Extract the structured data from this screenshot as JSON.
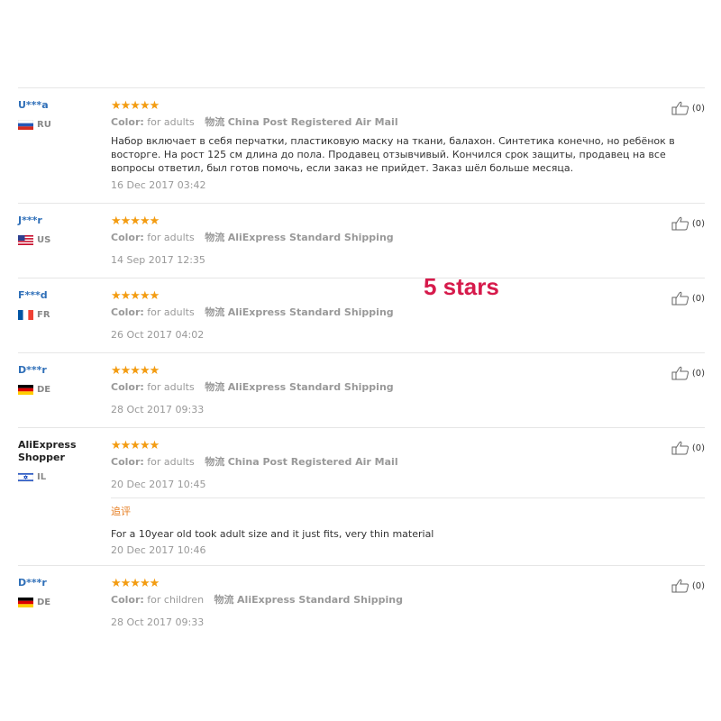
{
  "watermark": "5 stars",
  "labels": {
    "color": "Color:",
    "shipping": "物流"
  },
  "stars": "★★★★★",
  "reviews": [
    {
      "user": "U***a",
      "country": "RU",
      "color_value": "for adults",
      "shipping": "China Post Registered Air Mail",
      "text": "Набор включает в себя перчатки, пластиковую маску на ткани, балахон. Синтетика конечно, но ребёнок в восторге. На рост 125 см длина до пола. Продавец отзывчивый. Кончился срок защиты, продавец на все вопросы ответил, был готов помочь, если заказ не прийдет. Заказ шёл больше месяца.",
      "date": "16 Dec 2017 03:42",
      "likes": "(0)"
    },
    {
      "user": "J***r",
      "country": "US",
      "color_value": "for adults",
      "shipping": "AliExpress Standard Shipping",
      "date": "14 Sep 2017 12:35",
      "likes": "(0)"
    },
    {
      "user": "F***d",
      "country": "FR",
      "color_value": "for adults",
      "shipping": "AliExpress Standard Shipping",
      "date": "26 Oct 2017 04:02",
      "likes": "(0)"
    },
    {
      "user": "D***r",
      "country": "DE",
      "color_value": "for adults",
      "shipping": "AliExpress Standard Shipping",
      "date": "28 Oct 2017 09:33",
      "likes": "(0)"
    },
    {
      "user_line1": "AliExpress",
      "user_line2": "Shopper",
      "country": "IL",
      "color_value": "for adults",
      "shipping": "China Post Registered Air Mail",
      "date": "20 Dec 2017 10:45",
      "likes": "(0)",
      "append_label": "追评",
      "append_text": "For a 10year old took adult size and it just fits, very thin material",
      "append_date": "20 Dec 2017 10:46"
    },
    {
      "user": "D***r",
      "country": "DE",
      "color_value": "for children",
      "shipping": "AliExpress Standard Shipping",
      "date": "28 Oct 2017 09:33",
      "likes": "(0)"
    }
  ]
}
